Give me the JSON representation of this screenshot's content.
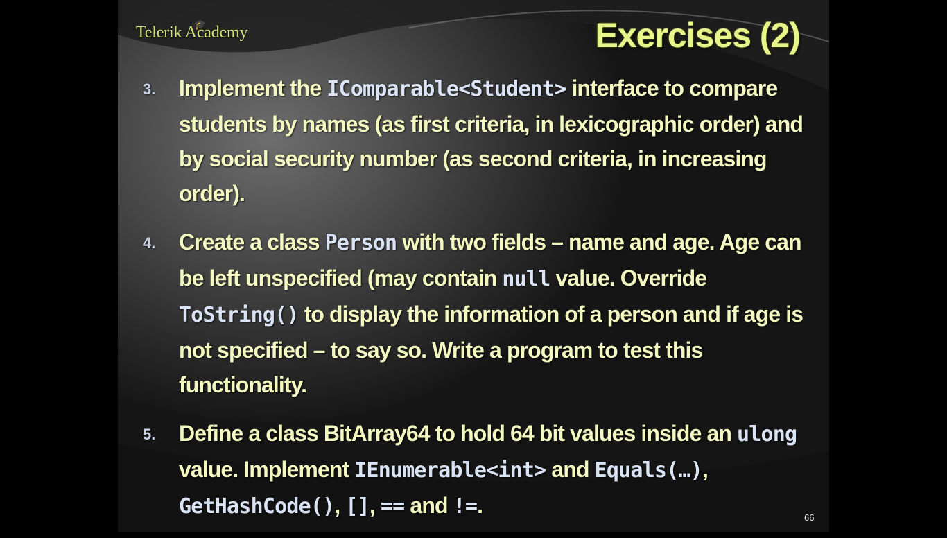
{
  "logo": {
    "text": "Telerik Academy"
  },
  "title": "Exercises (2)",
  "items": [
    {
      "number": "3.",
      "parts": [
        "Implement the ",
        "IComparable<Student>",
        " interface to compare students by names (as first criteria, in lexicographic order) and by social security number (as second criteria, in increasing order)."
      ]
    },
    {
      "number": "4.",
      "parts": [
        "Create a class ",
        "Person",
        " with two fields – name and age. Age can be left unspecified (may contain ",
        "null",
        " value. Override ",
        "ToString()",
        " to display the information of a person and if age is not specified – to say so. Write a program to test this functionality."
      ]
    },
    {
      "number": "5.",
      "parts": [
        "Define a class BitArray64 to hold 64 bit values inside an ",
        "ulong",
        " value. Implement ",
        "IEnumerable<int>",
        " and ",
        "Equals(…)",
        ", ",
        "GetHashCode()",
        ", ",
        "[]",
        ", ",
        "==",
        " and ",
        "!=",
        "."
      ]
    }
  ],
  "page_number": "66",
  "colors": {
    "title": "#e7f58a",
    "body_text": "#f3f7c0",
    "code_text": "#dbe4f5",
    "logo": "#cfe27a"
  }
}
